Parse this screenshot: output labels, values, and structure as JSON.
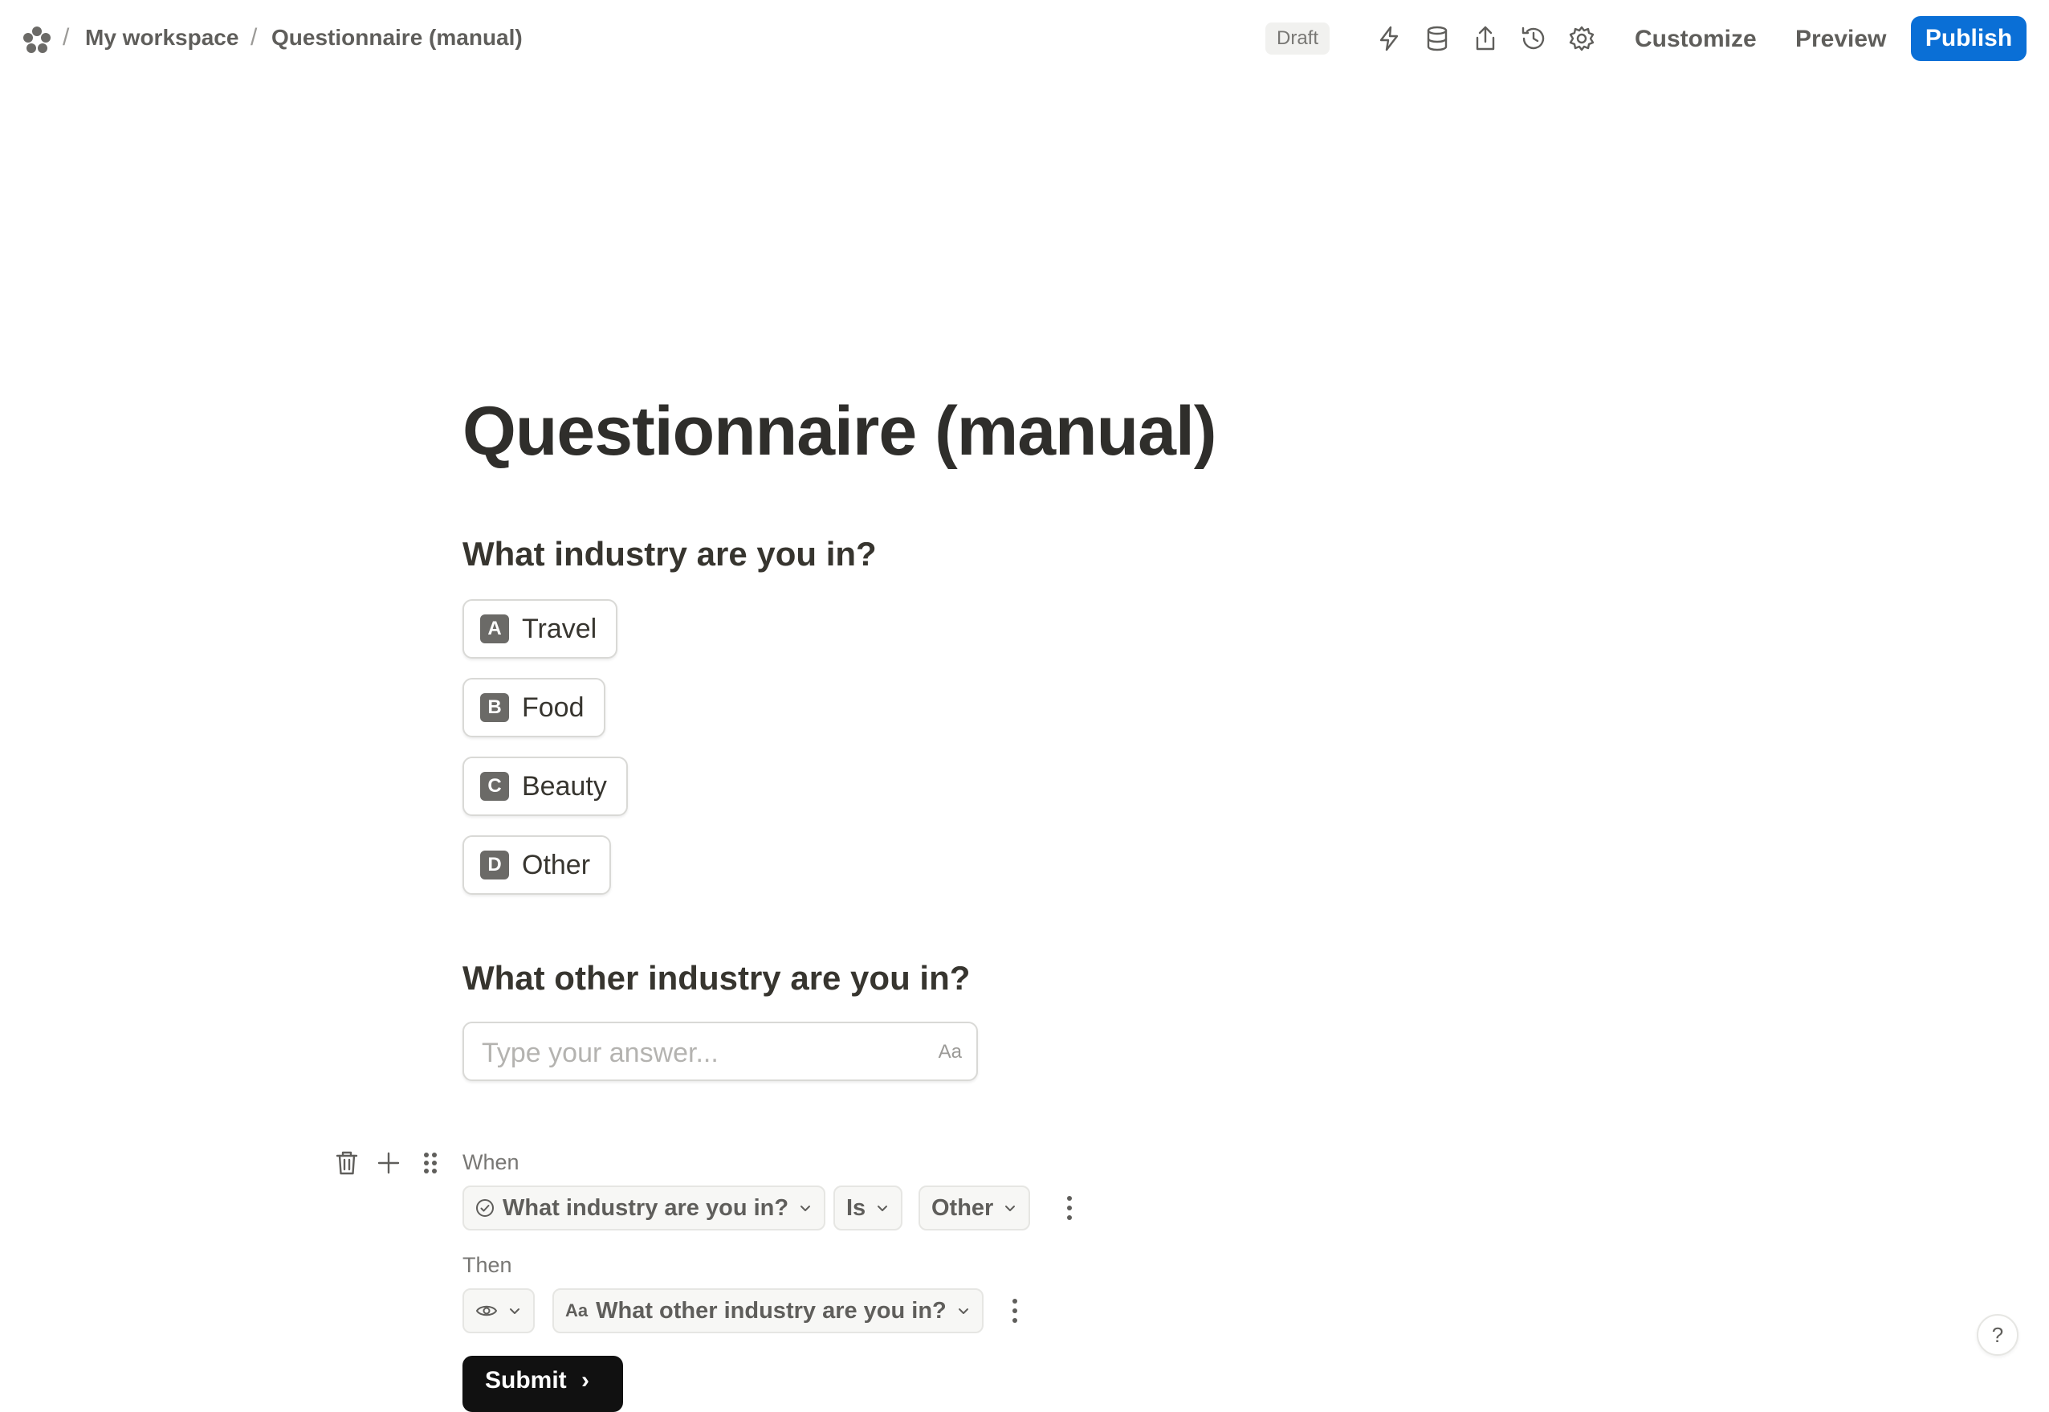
{
  "topbar": {
    "breadcrumb": [
      "My workspace",
      "Questionnaire (manual)"
    ],
    "separator": "/",
    "status_badge": "Draft",
    "icons": [
      "bolt-icon",
      "database-icon",
      "share-icon",
      "history-icon",
      "settings-icon"
    ],
    "customize_label": "Customize",
    "preview_label": "Preview",
    "publish_label": "Publish",
    "publish_color": "#0a6fd6"
  },
  "form": {
    "title": "Questionnaire (manual)",
    "q1": {
      "text": "What industry are you in?",
      "options": [
        {
          "key": "A",
          "label": "Travel"
        },
        {
          "key": "B",
          "label": "Food"
        },
        {
          "key": "C",
          "label": "Beauty"
        },
        {
          "key": "D",
          "label": "Other"
        }
      ]
    },
    "q2": {
      "text": "What other industry are you in?",
      "placeholder": "Type your answer...",
      "type_hint": "Aa"
    },
    "logic": {
      "when_label": "When",
      "condition_field": "What industry are you in?",
      "operator": "Is",
      "value": "Other",
      "then_label": "Then",
      "action_target_prefix": "Aa",
      "action_target": "What other industry are you in?"
    },
    "submit_label": "Submit"
  },
  "help_label": "?"
}
